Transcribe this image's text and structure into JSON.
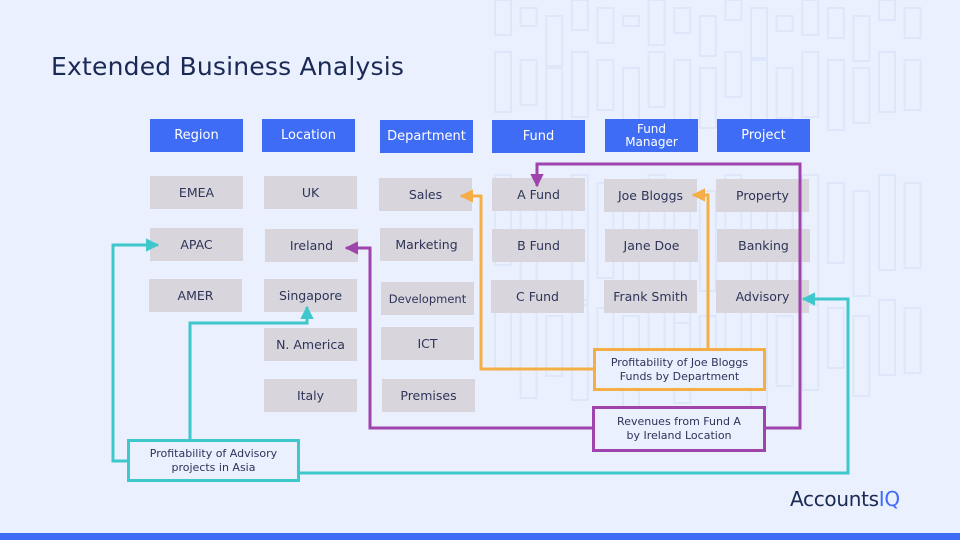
{
  "title": "Extended Business Analysis",
  "colors": {
    "background": "#eaf0fe",
    "header": "#3f6cf4",
    "cell": "#d8d6dc",
    "orange": "#f5ae45",
    "purple": "#a044ad",
    "teal": "#3ec8cc",
    "text_dark": "#1b2a55"
  },
  "columns": [
    {
      "header": "Region",
      "items": [
        "EMEA",
        "APAC",
        "AMER"
      ]
    },
    {
      "header": "Location",
      "items": [
        "UK",
        "Ireland",
        "Singapore",
        "N. America",
        "Italy"
      ]
    },
    {
      "header": "Department",
      "items": [
        "Sales",
        "Marketing",
        "Development",
        "ICT",
        "Premises"
      ]
    },
    {
      "header": "Fund",
      "items": [
        "A Fund",
        "B Fund",
        "C Fund"
      ]
    },
    {
      "header": "Fund\nManager",
      "items": [
        "Joe Bloggs",
        "Jane Doe",
        "Frank Smith"
      ]
    },
    {
      "header": "Project",
      "items": [
        "Property",
        "Banking",
        "Advisory"
      ]
    }
  ],
  "notes": {
    "joe_bloggs": {
      "text": "Profitability of Joe Bloggs\nFunds by Department",
      "color": "orange",
      "links": [
        "Joe Bloggs",
        "Sales"
      ]
    },
    "fund_a": {
      "text": "Revenues from Fund A\nby Ireland Location",
      "color": "purple",
      "links": [
        "A Fund",
        "Ireland"
      ]
    },
    "advisory": {
      "text": "Profitability of Advisory\nprojects in Asia",
      "color": "teal",
      "links": [
        "APAC",
        "Singapore",
        "Advisory"
      ]
    }
  },
  "logo": {
    "text": "Accounts",
    "accent": "IQ"
  }
}
